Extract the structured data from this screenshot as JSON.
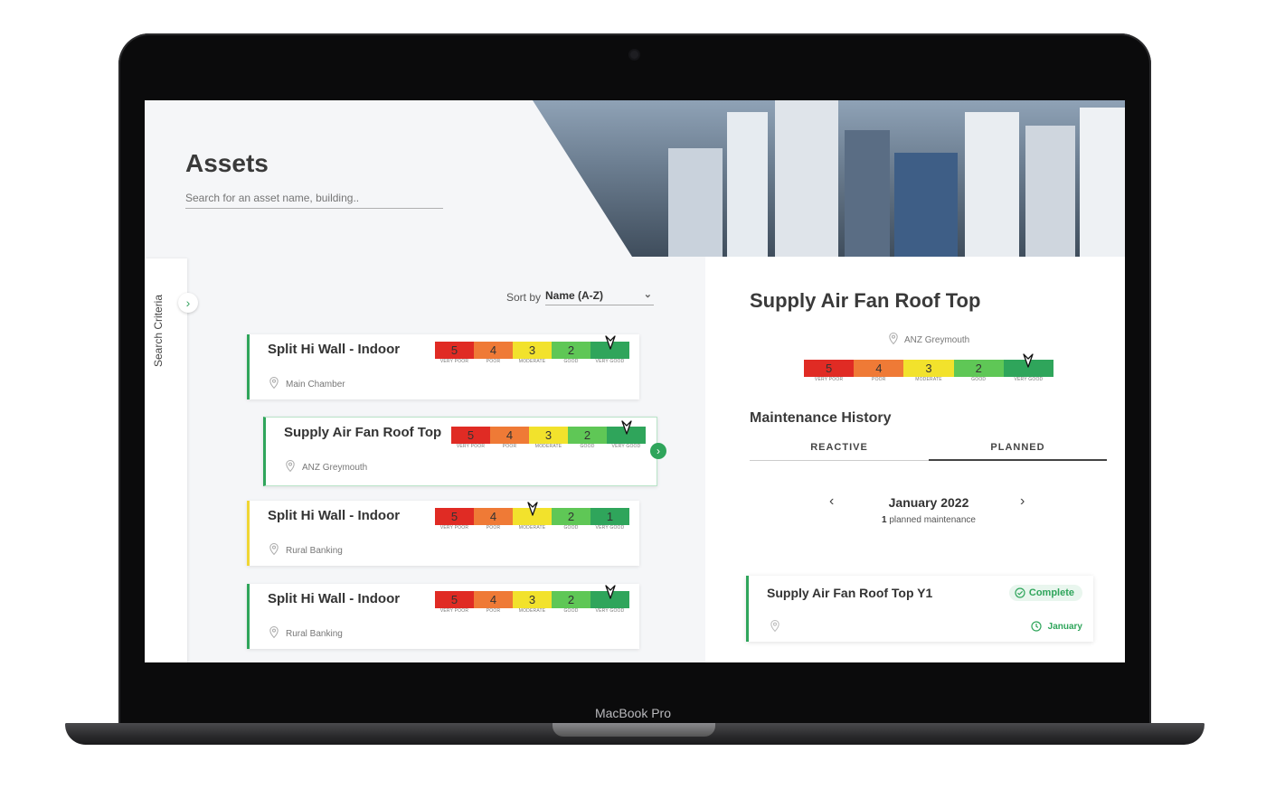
{
  "device": {
    "brand": "MacBook Pro"
  },
  "header": {
    "title": "Assets"
  },
  "search": {
    "placeholder": "Search for an asset name, building.."
  },
  "sidebar": {
    "label": "Search Criteria"
  },
  "sort": {
    "label": "Sort by",
    "value": "Name (A-Z)"
  },
  "scale_labels": [
    "VERY POOR",
    "POOR",
    "MODERATE",
    "GOOD",
    "VERY GOOD"
  ],
  "scale_colors": [
    "#e02b24",
    "#ef7a36",
    "#f2e22c",
    "#5fc756",
    "#2fa55b"
  ],
  "assets": [
    {
      "name": "Split Hi Wall - Indoor",
      "location": "Main Chamber",
      "scale": [
        "5",
        "4",
        "3",
        "2",
        ""
      ],
      "rating": 1
    },
    {
      "name": "Supply Air Fan Roof Top",
      "location": "ANZ Greymouth",
      "scale": [
        "5",
        "4",
        "3",
        "2",
        ""
      ],
      "rating": 1
    },
    {
      "name": "Split Hi Wall - Indoor",
      "location": "Rural Banking",
      "scale": [
        "5",
        "4",
        "",
        "2",
        "1"
      ],
      "rating": 3
    },
    {
      "name": "Split Hi Wall - Indoor",
      "location": "Rural Banking",
      "scale": [
        "5",
        "4",
        "3",
        "2",
        ""
      ],
      "rating": 1
    }
  ],
  "detail": {
    "title": "Supply Air Fan Roof Top",
    "location": "ANZ Greymouth",
    "scale": [
      "5",
      "4",
      "3",
      "2",
      ""
    ],
    "rating": 1,
    "maintenance": {
      "title": "Maintenance History",
      "tabs": [
        "REACTIVE",
        "PLANNED"
      ],
      "active_tab": "PLANNED",
      "month": "January 2022",
      "count": "1",
      "count_text": " planned maintenance",
      "items": [
        {
          "title": "Supply Air Fan Roof Top Y1",
          "status": "Complete",
          "date": "January"
        }
      ]
    }
  }
}
